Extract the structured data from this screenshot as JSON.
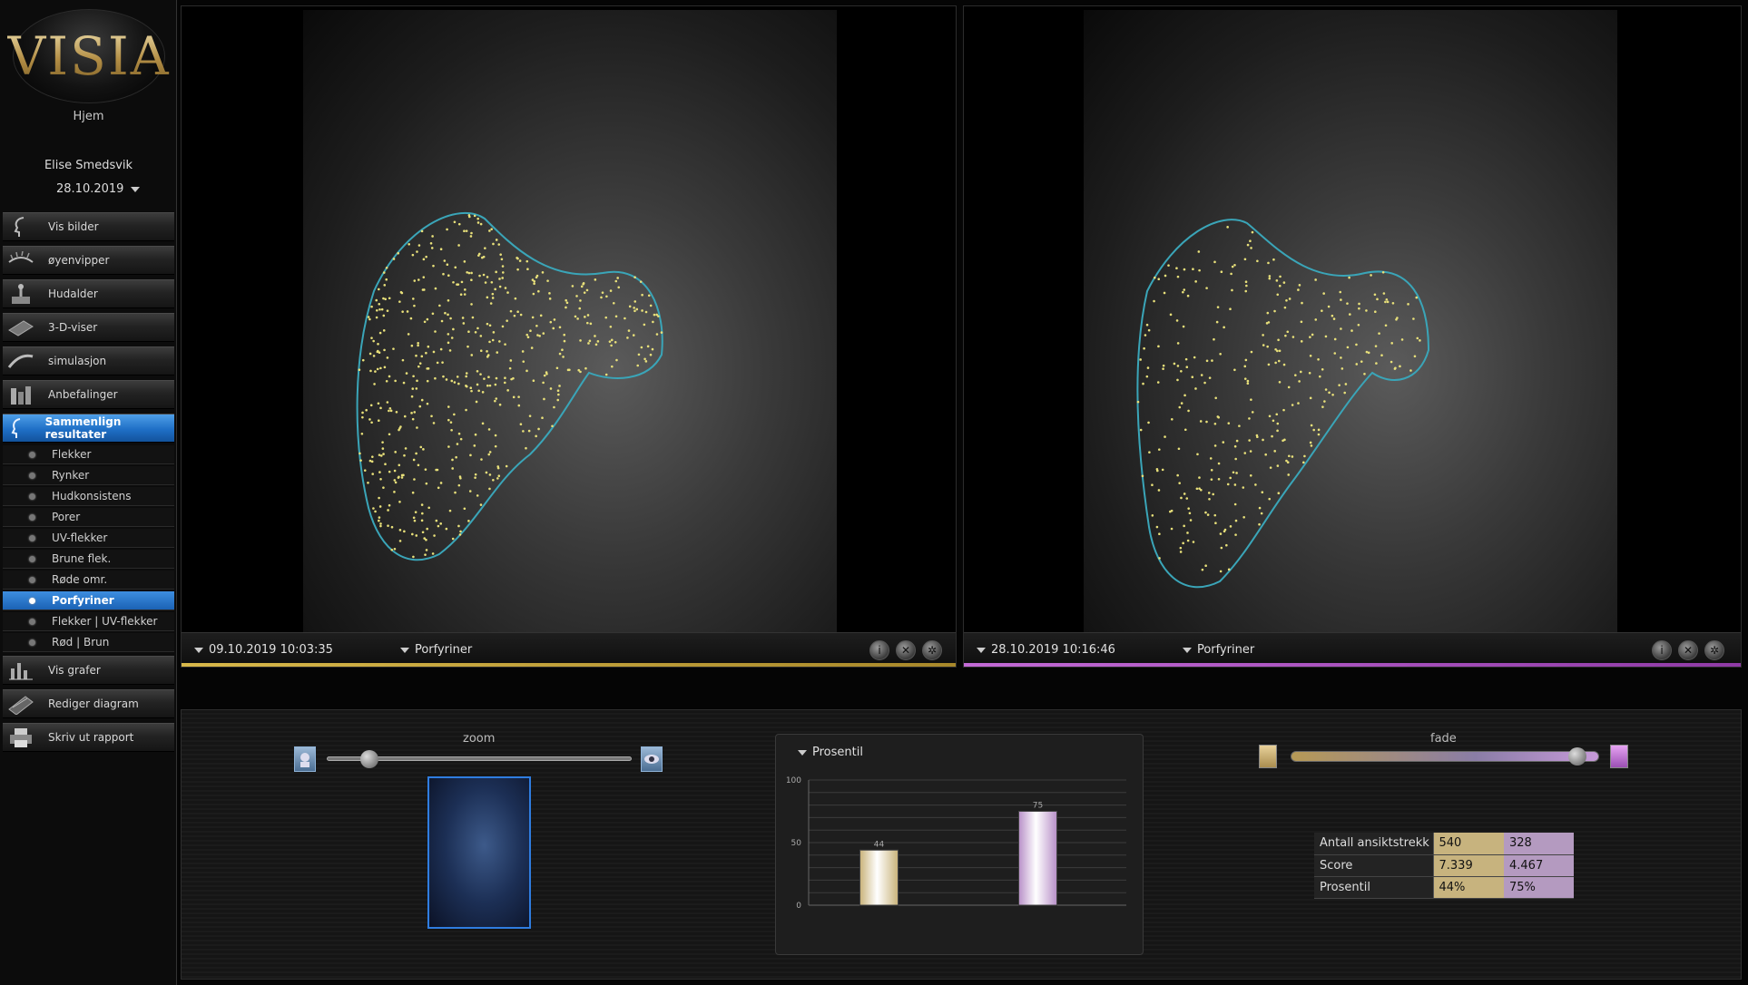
{
  "app": {
    "logo_text": "VISIA",
    "home_label": "Hjem"
  },
  "patient": {
    "name": "Elise Smedsvik",
    "session_date": "28.10.2019"
  },
  "nav": {
    "items": [
      {
        "label": "Vis bilder",
        "icon": "face-profile-icon"
      },
      {
        "label": "øyenvipper",
        "icon": "eyelash-icon"
      },
      {
        "label": "Hudalder",
        "icon": "joystick-icon"
      },
      {
        "label": "3-D-viser",
        "icon": "3d-surface-icon"
      },
      {
        "label": "simulasjon",
        "icon": "simulation-icon"
      },
      {
        "label": "Anbefalinger",
        "icon": "products-icon"
      },
      {
        "label": "Sammenlign resultater",
        "icon": "compare-faces-icon",
        "active": true
      }
    ],
    "sub_items": [
      {
        "label": "Flekker"
      },
      {
        "label": "Rynker"
      },
      {
        "label": "Hudkonsistens"
      },
      {
        "label": "Porer"
      },
      {
        "label": "UV-flekker"
      },
      {
        "label": "Brune flek."
      },
      {
        "label": "Røde omr."
      },
      {
        "label": "Porfyriner",
        "active": true
      },
      {
        "label": "Flekker | UV-flekker"
      },
      {
        "label": "Rød | Brun"
      }
    ],
    "bottom_items": [
      {
        "label": "Vis grafer",
        "icon": "bar-graph-icon"
      },
      {
        "label": "Rediger diagram",
        "icon": "edit-chart-icon"
      },
      {
        "label": "Skriv ut rapport",
        "icon": "printer-icon"
      }
    ]
  },
  "viewers": {
    "left": {
      "timestamp": "09.10.2019 10:03:35",
      "mode": "Porfyriner",
      "accent": "#d8b84a"
    },
    "right": {
      "timestamp": "28.10.2019 10:16:46",
      "mode": "Porfyriner",
      "accent": "#c36ad6"
    }
  },
  "controls": {
    "zoom_label": "zoom",
    "zoom_level": 0.14,
    "fade_label": "fade",
    "fade_level": 0.93
  },
  "percentile_panel": {
    "title": "Prosentil"
  },
  "chart_data": {
    "type": "bar",
    "categories": [
      "09.10.2019",
      "28.10.2019"
    ],
    "values": [
      44,
      75
    ],
    "colors": [
      "#c9b37a",
      "#b890c8"
    ],
    "ylim": [
      0,
      100
    ],
    "yticks": [
      0,
      50,
      100
    ],
    "grid": true
  },
  "stats_table": {
    "rows": [
      {
        "label": "Antall ansiktstrekk",
        "v1": "540",
        "v2": "328"
      },
      {
        "label": "Score",
        "v1": "7.339",
        "v2": "4.467"
      },
      {
        "label": "Prosentil",
        "v1": "44%",
        "v2": "75%"
      }
    ]
  }
}
